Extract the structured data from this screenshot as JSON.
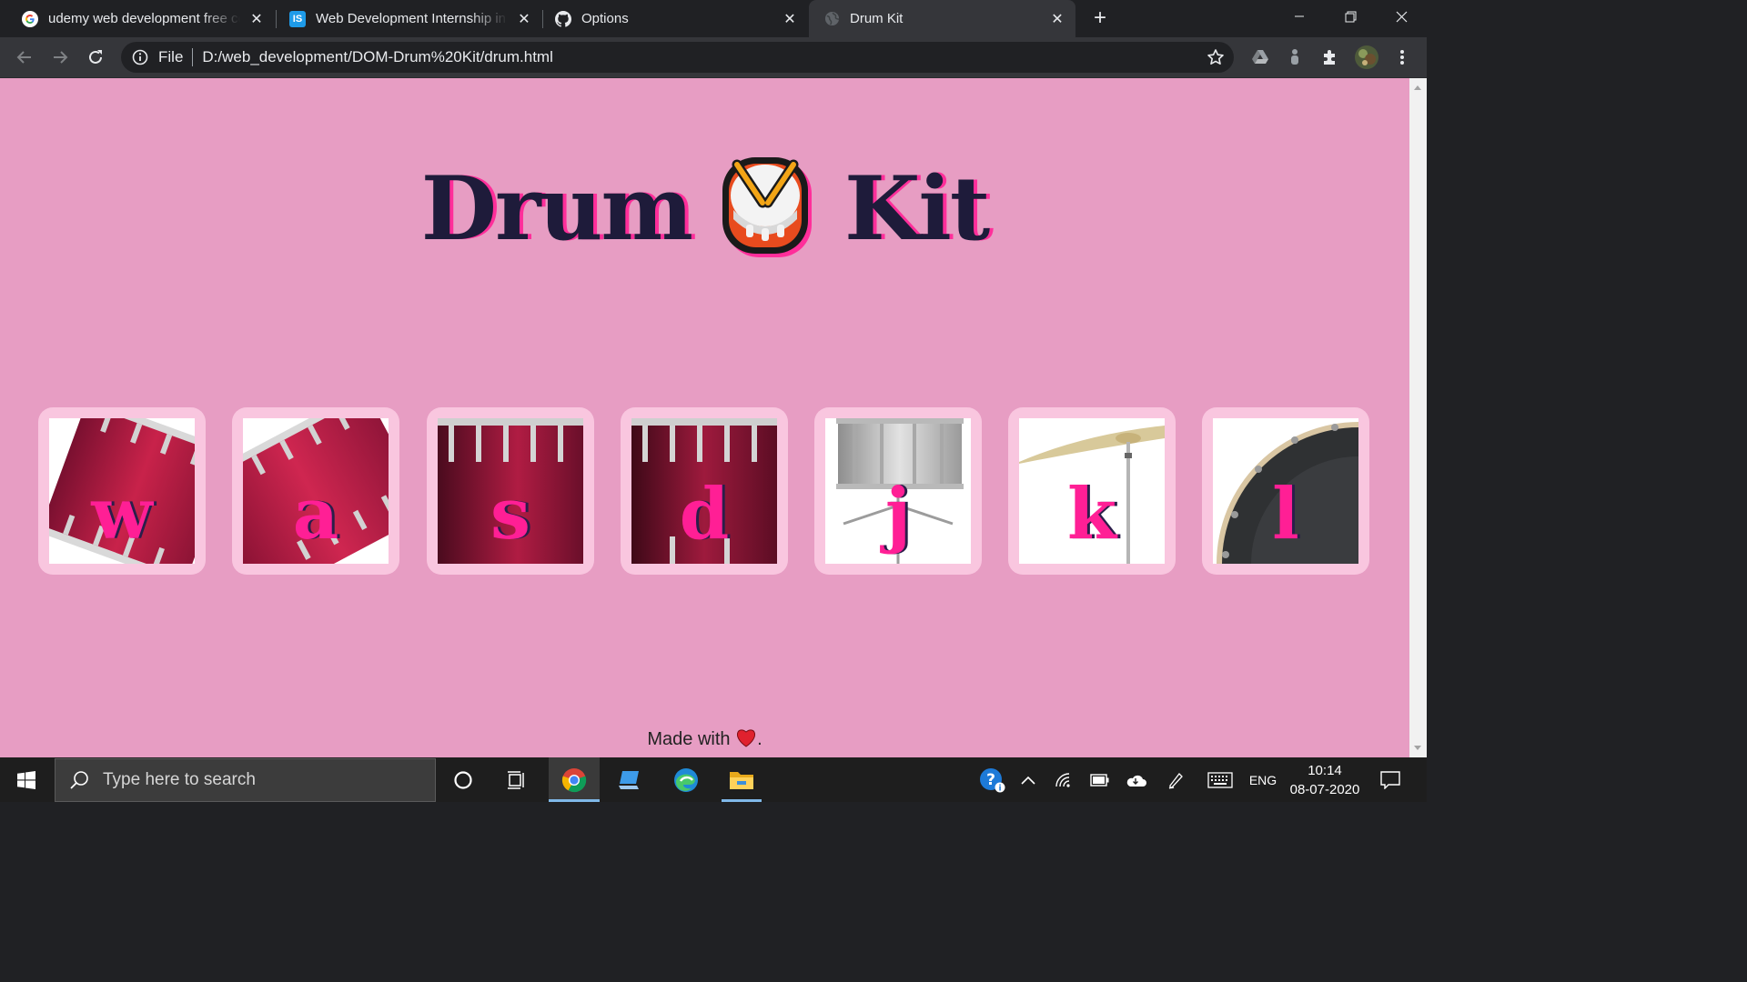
{
  "browser": {
    "tabs": [
      {
        "title": "udemy web development free co",
        "icon": "google-icon",
        "active": false
      },
      {
        "title": "Web Development Internship in C",
        "icon": "internshala-icon",
        "active": false
      },
      {
        "title": "Options",
        "icon": "github-icon",
        "active": false
      },
      {
        "title": "Drum Kit",
        "icon": "globe-icon",
        "active": true
      }
    ],
    "internshala_favicon_text": "IS",
    "address_scheme": "File",
    "address_url": "D:/web_development/DOM-Drum%20Kit/drum.html"
  },
  "page": {
    "title_left": "Drum",
    "title_right": "Kit",
    "drums": [
      {
        "key": "w",
        "image": "tom-1"
      },
      {
        "key": "a",
        "image": "tom-2"
      },
      {
        "key": "s",
        "image": "tom-3"
      },
      {
        "key": "d",
        "image": "tom-4"
      },
      {
        "key": "j",
        "image": "snare"
      },
      {
        "key": "k",
        "image": "crash"
      },
      {
        "key": "l",
        "image": "kick"
      }
    ],
    "footer_text": "Made with",
    "footer_suffix": ".",
    "background_color": "#e79dc3",
    "accent_color": "#ff1f95",
    "title_color": "#1e1b3a"
  },
  "taskbar": {
    "search_placeholder": "Type here to search",
    "language": "ENG",
    "time": "10:14",
    "date": "08-07-2020"
  }
}
